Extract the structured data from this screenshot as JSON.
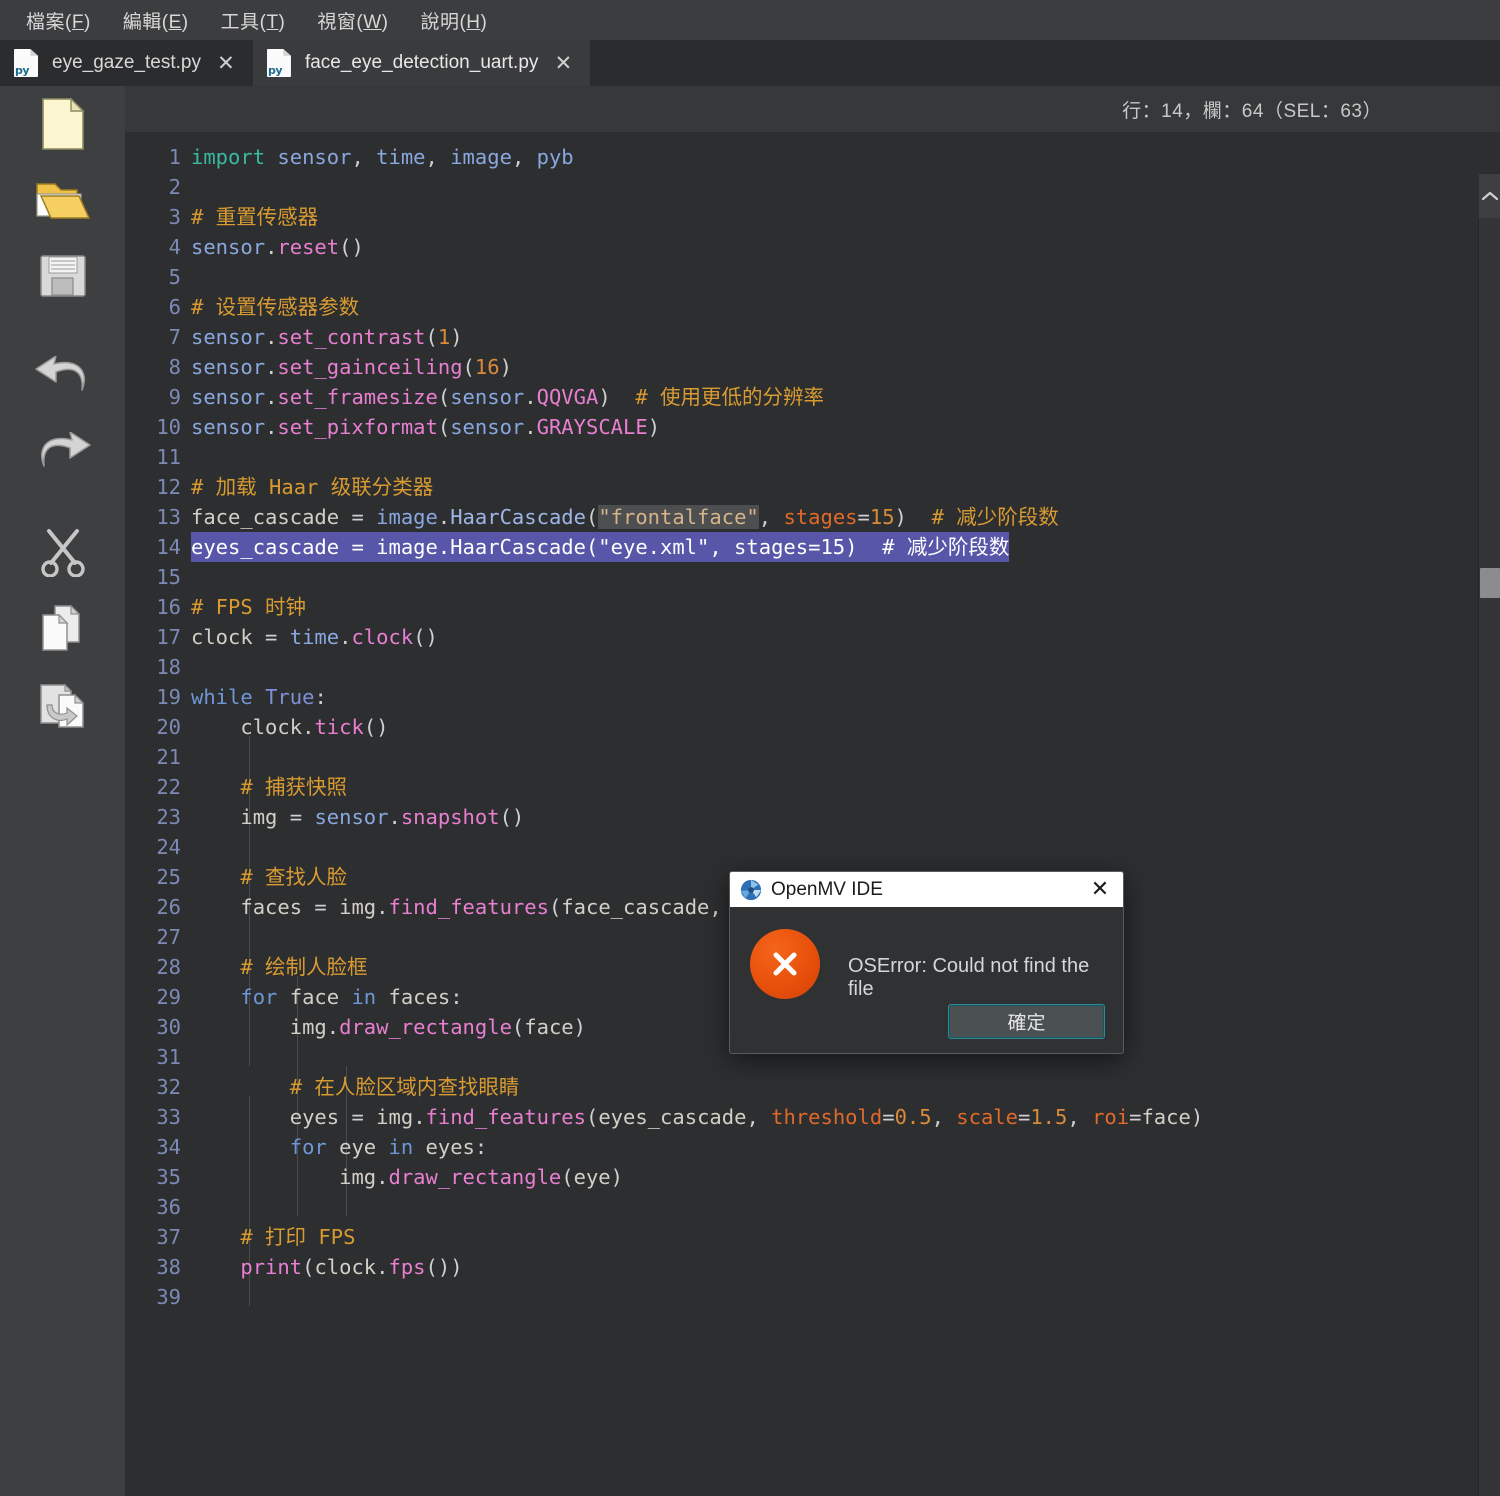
{
  "menubar": {
    "items": [
      {
        "name": "file",
        "label": "檔案(",
        "key": "F",
        "tail": ")"
      },
      {
        "name": "edit",
        "label": "編輯(",
        "key": "E",
        "tail": ")"
      },
      {
        "name": "tools",
        "label": "工具(",
        "key": "T",
        "tail": ")"
      },
      {
        "name": "window",
        "label": "視窗(",
        "key": "W",
        "tail": ")"
      },
      {
        "name": "help",
        "label": "說明(",
        "key": "H",
        "tail": ")"
      }
    ]
  },
  "tabs": [
    {
      "label": "eye_gaze_test.py",
      "icon": "python-file-icon",
      "close": "✕",
      "active": false
    },
    {
      "label": "face_eye_detection_uart.py",
      "icon": "python-file-icon",
      "close": "✕",
      "active": true
    }
  ],
  "toolbar": {
    "items": [
      {
        "name": "new-file-icon",
        "title": "新增"
      },
      {
        "name": "open-folder-icon",
        "title": "開啟"
      },
      {
        "name": "save-icon",
        "title": "儲存"
      },
      {
        "name": "undo-icon",
        "title": "復原"
      },
      {
        "name": "redo-icon",
        "title": "重做"
      },
      {
        "name": "cut-icon",
        "title": "剪下"
      },
      {
        "name": "copy-icon",
        "title": "複製"
      },
      {
        "name": "paste-icon",
        "title": "貼上"
      }
    ]
  },
  "status": {
    "text": "行：14，欄：64（SEL：63）",
    "line": 14,
    "column": 64,
    "selection": 63
  },
  "editor": {
    "total_lines": 39,
    "selected_line": 14,
    "first_line": 1,
    "lines": [
      {
        "n": 1,
        "text": "import sensor, time, image, pyb"
      },
      {
        "n": 2,
        "text": ""
      },
      {
        "n": 3,
        "text": "# 重置传感器"
      },
      {
        "n": 4,
        "text": "sensor.reset()"
      },
      {
        "n": 5,
        "text": ""
      },
      {
        "n": 6,
        "text": "# 设置传感器参数"
      },
      {
        "n": 7,
        "text": "sensor.set_contrast(1)"
      },
      {
        "n": 8,
        "text": "sensor.set_gainceiling(16)"
      },
      {
        "n": 9,
        "text": "sensor.set_framesize(sensor.QQVGA)  # 使用更低的分辨率"
      },
      {
        "n": 10,
        "text": "sensor.set_pixformat(sensor.GRAYSCALE)"
      },
      {
        "n": 11,
        "text": ""
      },
      {
        "n": 12,
        "text": "# 加载 Haar 级联分类器"
      },
      {
        "n": 13,
        "text": "face_cascade = image.HaarCascade(\"frontalface\", stages=15)  # 减少阶段数"
      },
      {
        "n": 14,
        "text": "eyes_cascade = image.HaarCascade(\"eye.xml\", stages=15)  # 减少阶段数"
      },
      {
        "n": 15,
        "text": ""
      },
      {
        "n": 16,
        "text": "# FPS 时钟"
      },
      {
        "n": 17,
        "text": "clock = time.clock()"
      },
      {
        "n": 18,
        "text": ""
      },
      {
        "n": 19,
        "text": "while True:"
      },
      {
        "n": 20,
        "text": "    clock.tick()"
      },
      {
        "n": 21,
        "text": ""
      },
      {
        "n": 22,
        "text": "    # 捕获快照"
      },
      {
        "n": 23,
        "text": "    img = sensor.snapshot()"
      },
      {
        "n": 24,
        "text": ""
      },
      {
        "n": 25,
        "text": "    # 查找人脸"
      },
      {
        "n": 26,
        "text": "    faces = img.find_features(face_cascade, threshold=0.5, scale=1.5)"
      },
      {
        "n": 27,
        "text": ""
      },
      {
        "n": 28,
        "text": "    # 绘制人脸框"
      },
      {
        "n": 29,
        "text": "    for face in faces:"
      },
      {
        "n": 30,
        "text": "        img.draw_rectangle(face)"
      },
      {
        "n": 31,
        "text": ""
      },
      {
        "n": 32,
        "text": "        # 在人脸区域内查找眼睛"
      },
      {
        "n": 33,
        "text": "        eyes = img.find_features(eyes_cascade, threshold=0.5, scale=1.5, roi=face)"
      },
      {
        "n": 34,
        "text": "        for eye in eyes:"
      },
      {
        "n": 35,
        "text": "            img.draw_rectangle(eye)"
      },
      {
        "n": 36,
        "text": ""
      },
      {
        "n": 37,
        "text": "    # 打印 FPS"
      },
      {
        "n": 38,
        "text": "    print(clock.fps())"
      },
      {
        "n": 39,
        "text": ""
      }
    ],
    "occurrence_highlight": "frontalface"
  },
  "scrollbar": {
    "up_arrow": "⌃",
    "thumb_position_percent": 28
  },
  "dialog": {
    "title": "OpenMV IDE",
    "icon": "openmv-aperture-icon",
    "close": "✕",
    "error_icon": "error-x-icon",
    "message": "OSError: Could not find the file",
    "ok_label": "確定"
  },
  "colors": {
    "menubar_bg": "#3c3d3f",
    "tabbar_bg": "#2b2c2e",
    "tab_active_bg": "#3a3b3d",
    "sidebar_bg": "#3e3f41",
    "editor_bg": "#2c2e30",
    "statusline_bg": "#36383a",
    "selection": "#5756a8",
    "comment": "#d99b31",
    "keyword": "#6f96d6",
    "function": "#e87fd0",
    "string": "#d6b48a",
    "number": "#d98b3a",
    "kwarg": "#e06a2a",
    "linenumber": "#7d8ab5",
    "error_orange": "#e8500b",
    "dialog_bg": "#303133",
    "dialog_title_bg": "#ffffff",
    "button_focus": "#2e8b96"
  }
}
